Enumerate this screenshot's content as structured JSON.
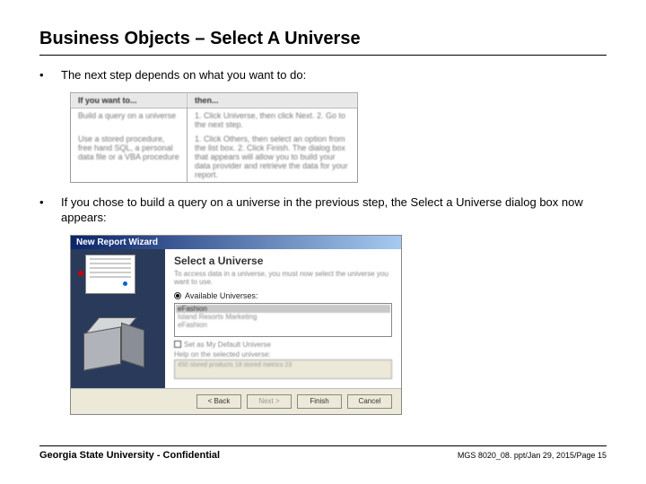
{
  "title": "Business Objects – Select A Universe",
  "bullets": [
    "The next step depends on what you want to do:",
    "If you chose to build a query on a universe in the previous step, the Select a Universe dialog box now appears:"
  ],
  "decision_table": {
    "headers": [
      "If you want to...",
      "then..."
    ],
    "rows": [
      [
        "Build a query on a universe",
        "1. Click Universe, then click Next.\n2. Go to the next step."
      ],
      [
        "Use a stored procedure, free hand SQL, a personal data file or a VBA procedure",
        "1. Click Others, then select an option from the list box.\n2. Click Finish. The dialog box that appears will allow you to build your data provider and retrieve the data for your report."
      ]
    ]
  },
  "wizard": {
    "window_title": "New Report Wizard",
    "panel_title": "Select a Universe",
    "panel_subtitle": "To access data in a universe, you must now select the universe you want to use.",
    "radio_available": "Available Universes:",
    "listbox_items": [
      "eFashion",
      "Island Resorts Marketing",
      "eFashion"
    ],
    "checkbox_label": "Set as My Default Universe",
    "help_label": "Help on the selected universe:",
    "help_text": "450 stored products 18 stored metrics 23",
    "buttons": {
      "back": "< Back",
      "next": "Next >",
      "finish": "Finish",
      "cancel": "Cancel"
    }
  },
  "footer": {
    "left": "Georgia State University - Confidential",
    "right": "MGS 8020_08. ppt/Jan 29, 2015/Page 15"
  }
}
